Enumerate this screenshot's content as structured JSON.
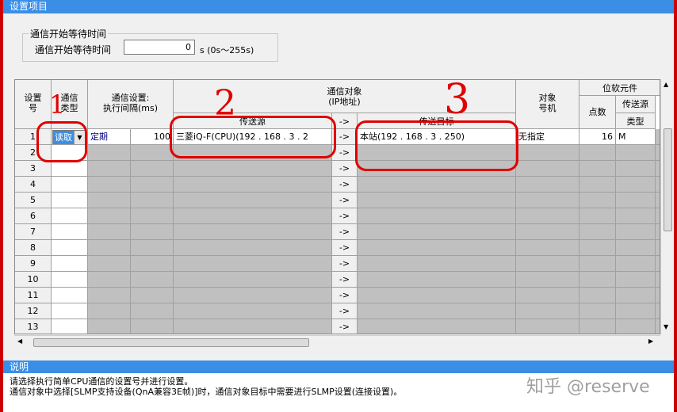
{
  "window": {
    "title": "设置项目"
  },
  "wait": {
    "group_title": "通信开始等待时间",
    "label": "通信开始等待时间",
    "value": "0",
    "unit": "s (0s～255s)"
  },
  "headers": {
    "setting_no": "设置\n号",
    "comm_type": "通信\n类型",
    "comm_setting": "通信设置:\n执行间隔(ms)",
    "comm_target": "通信对象\n(IP地址)",
    "source": "传送源",
    "dest": "传送目标",
    "arrow": "->",
    "target_station": "对象\n号机",
    "bit_device": "位软元件",
    "points": "点数",
    "send_source": "传送源",
    "type": "类型"
  },
  "rows": [
    {
      "no": "1",
      "type": "读取",
      "setting": "定期",
      "interval": "100",
      "source": "三菱iQ-F(CPU)(192 .  168 .   3 .  2",
      "arrow": "->",
      "dest": "本站(192 .  168 .   3 .  250)",
      "target": "无指定",
      "points": "16",
      "dtype": "M"
    },
    {
      "no": "2",
      "arrow": "->"
    },
    {
      "no": "3",
      "arrow": "->"
    },
    {
      "no": "4",
      "arrow": "->"
    },
    {
      "no": "5",
      "arrow": "->"
    },
    {
      "no": "6",
      "arrow": "->"
    },
    {
      "no": "7",
      "arrow": "->"
    },
    {
      "no": "8",
      "arrow": "->"
    },
    {
      "no": "9",
      "arrow": "->"
    },
    {
      "no": "10",
      "arrow": "->"
    },
    {
      "no": "11",
      "arrow": "->"
    },
    {
      "no": "12",
      "arrow": "->"
    },
    {
      "no": "13",
      "arrow": "->"
    }
  ],
  "description": {
    "title": "说明",
    "line1": "请选择执行简单CPU通信的设置号并进行设置。",
    "line2": "通信对象中选择[SLMP支持设备(QnA兼容3E帧)]时，通信对象目标中需要进行SLMP设置(连接设置)。"
  },
  "annotations": {
    "a1": "1",
    "a2": "2",
    "a3": "3"
  },
  "watermark": "知乎 @reserve",
  "colors": {
    "accent": "#3a8ee6",
    "annotation": "#e00000",
    "disabled": "#c0c0c0"
  }
}
